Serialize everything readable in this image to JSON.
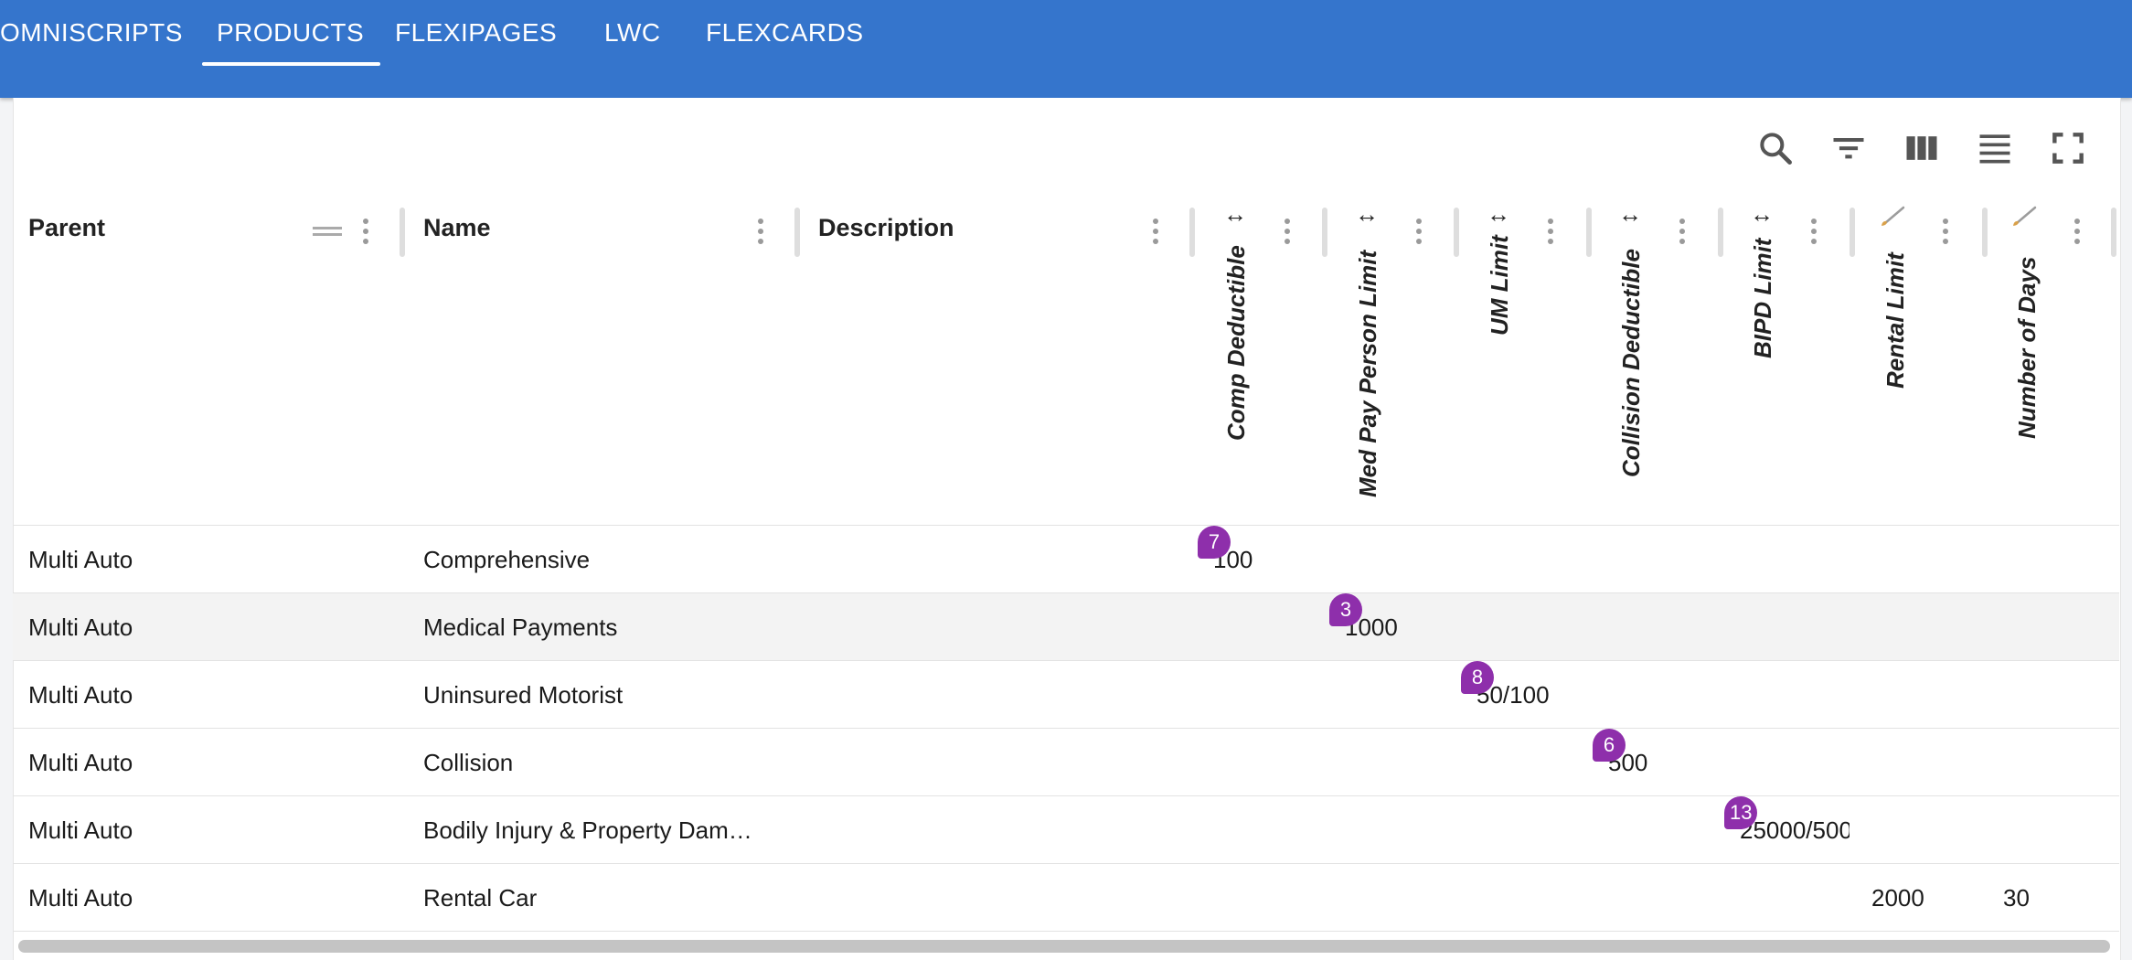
{
  "nav": {
    "tabs": [
      {
        "label": "OMNISCRIPTS"
      },
      {
        "label": "PRODUCTS"
      },
      {
        "label": "FLEXIPAGES"
      },
      {
        "label": "LWC"
      },
      {
        "label": "FLEXCARDS"
      }
    ],
    "active_tab": "PRODUCTS"
  },
  "toolbar": {
    "icons": [
      "search-icon",
      "filter-icon",
      "columns-icon",
      "density-icon",
      "fullscreen-icon"
    ]
  },
  "table": {
    "columns": [
      {
        "title": "Parent"
      },
      {
        "title": "Name"
      },
      {
        "title": "Description"
      },
      {
        "title": "Comp Deductible",
        "indicator": "↔"
      },
      {
        "title": "Med Pay Person Limit",
        "indicator": "↔"
      },
      {
        "title": "UM Limit",
        "indicator": "↔"
      },
      {
        "title": "Collision Deductible",
        "indicator": "↔"
      },
      {
        "title": "BIPD Limit",
        "indicator": "↔"
      },
      {
        "title": "Rental Limit",
        "indicator": "brush-icon"
      },
      {
        "title": "Number of Days",
        "indicator": "brush-icon"
      }
    ],
    "rows": [
      {
        "parent": "Multi Auto",
        "name": "Comprehensive",
        "value": "100",
        "badge": "7"
      },
      {
        "parent": "Multi Auto",
        "name": "Medical Payments",
        "value": "1000",
        "badge": "3"
      },
      {
        "parent": "Multi Auto",
        "name": "Uninsured Motorist",
        "value": "50/100",
        "badge": "8"
      },
      {
        "parent": "Multi Auto",
        "name": "Collision",
        "value": "500",
        "badge": "6"
      },
      {
        "parent": "Multi Auto",
        "name": "Bodily Injury & Property Dam…",
        "value": "25000/500",
        "badge": "13"
      },
      {
        "parent": "Multi Auto",
        "name": "Rental Car",
        "rental_limit": "2000",
        "number_of_days": "30"
      }
    ]
  },
  "colors": {
    "header_blue": "#3575cc",
    "badge_purple": "#8e2fab"
  }
}
